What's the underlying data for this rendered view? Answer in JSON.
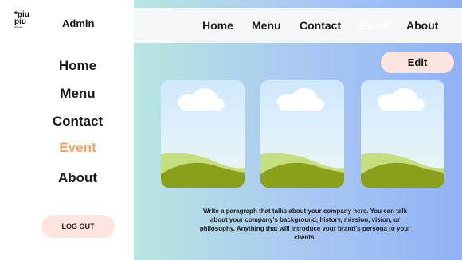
{
  "sidebar": {
    "logo": {
      "line1": "*piu",
      "line2": "piu",
      "line3": "Discuss"
    },
    "admin_label": "Admin",
    "items": [
      {
        "label": "Home",
        "active": false
      },
      {
        "label": "Menu",
        "active": false
      },
      {
        "label": "Contact",
        "active": false
      },
      {
        "label": "Event",
        "active": true
      },
      {
        "label": "About",
        "active": false
      }
    ],
    "logout_label": "LOG OUT"
  },
  "topnav": {
    "items": [
      {
        "label": "Home"
      },
      {
        "label": "Menu"
      },
      {
        "label": "Contact"
      },
      {
        "label": "Event"
      },
      {
        "label": "About"
      }
    ]
  },
  "main": {
    "edit_label": "Edit",
    "cards": [
      {
        "icon": "landscape-image-placeholder-icon"
      },
      {
        "icon": "landscape-image-placeholder-icon"
      },
      {
        "icon": "landscape-image-placeholder-icon"
      }
    ],
    "paragraph": "Write a paragraph that talks about your company here. You can talk about your company's background, history, mission, vision, or philosophy. Anything that will introduce your brand's persona to your clients."
  },
  "colors": {
    "active_nav": "#f5a25d",
    "button_bg": "#fde4de",
    "gradient_start": "#b8e6e1",
    "gradient_end": "#8fb2f5",
    "hill_dark": "#8aa01a",
    "hill_light": "#c5de7e"
  }
}
